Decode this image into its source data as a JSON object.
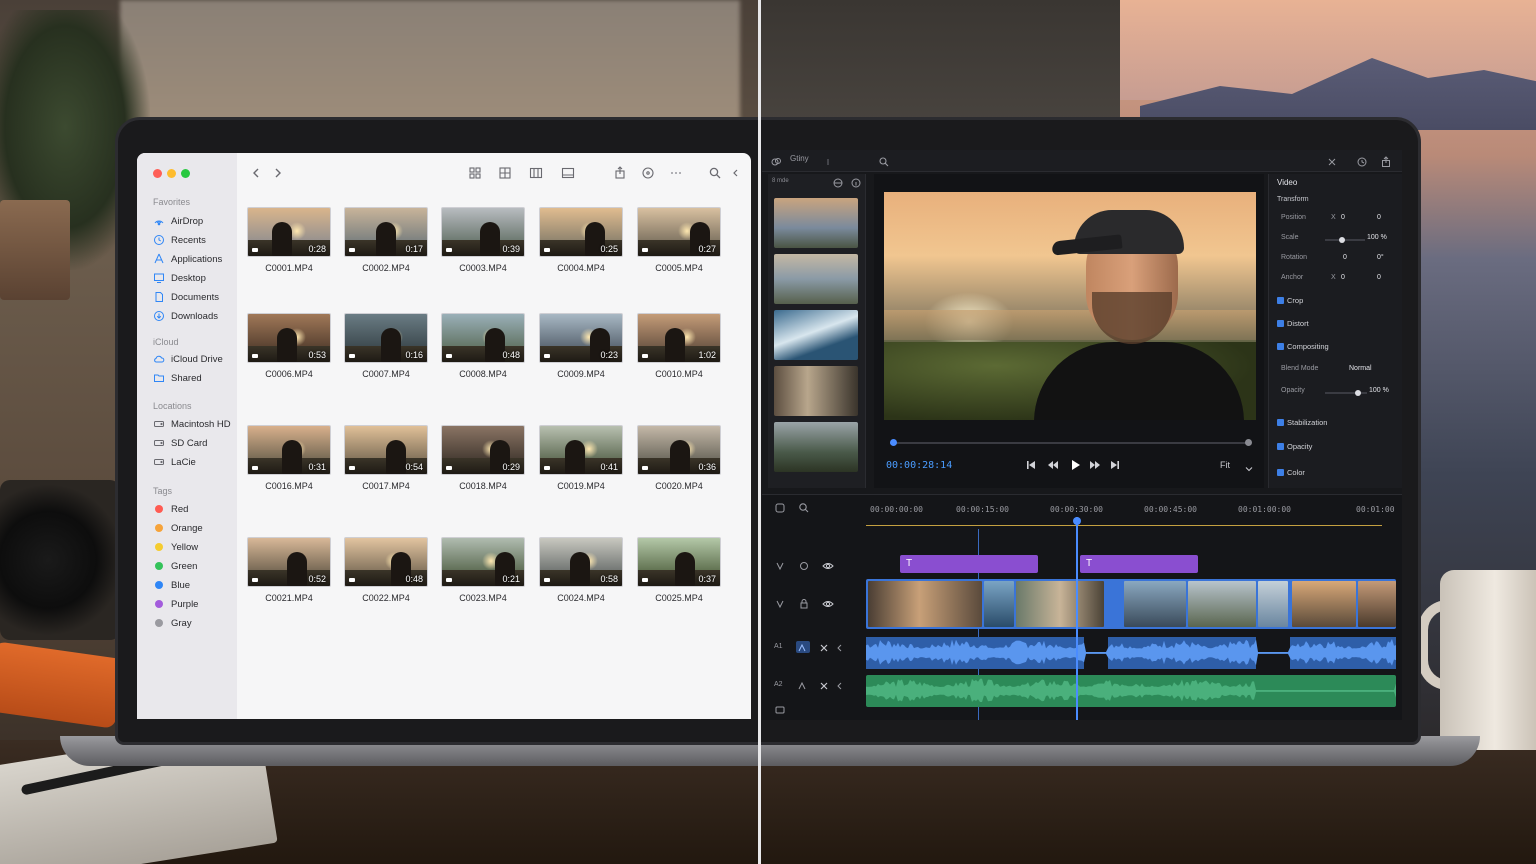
{
  "finder": {
    "sidebar": {
      "favorites_label": "Favorites",
      "favorites": [
        {
          "label": "AirDrop",
          "icon": "airdrop-icon"
        },
        {
          "label": "Recents",
          "icon": "clock-icon"
        },
        {
          "label": "Applications",
          "icon": "applications-icon"
        },
        {
          "label": "Desktop",
          "icon": "desktop-icon"
        },
        {
          "label": "Documents",
          "icon": "document-icon"
        },
        {
          "label": "Downloads",
          "icon": "download-icon"
        }
      ],
      "icloud_label": "iCloud",
      "icloud": [
        {
          "label": "iCloud Drive",
          "icon": "cloud-icon"
        },
        {
          "label": "Shared",
          "icon": "shared-folder-icon"
        }
      ],
      "locations_label": "Locations",
      "locations": [
        {
          "label": "Macintosh HD",
          "icon": "disk-icon"
        },
        {
          "label": "SD Card",
          "icon": "disk-icon"
        },
        {
          "label": "LaCie",
          "icon": "disk-icon"
        }
      ],
      "tags_label": "Tags",
      "tags": [
        {
          "label": "Red",
          "color": "#ff5b52"
        },
        {
          "label": "Orange",
          "color": "#f6a33a"
        },
        {
          "label": "Yellow",
          "color": "#f5cc2f"
        },
        {
          "label": "Green",
          "color": "#34c25a"
        },
        {
          "label": "Blue",
          "color": "#2f86f6"
        },
        {
          "label": "Purple",
          "color": "#a35cdc"
        },
        {
          "label": "Gray",
          "color": "#9a9aa0"
        }
      ]
    },
    "files": [
      {
        "name": "C0001.MP4",
        "duration": "0:28"
      },
      {
        "name": "C0002.MP4",
        "duration": "0:17"
      },
      {
        "name": "C0003.MP4",
        "duration": "0:39"
      },
      {
        "name": "C0004.MP4",
        "duration": "0:25"
      },
      {
        "name": "C0005.MP4",
        "duration": "0:27"
      },
      {
        "name": "C0006.MP4",
        "duration": "0:53"
      },
      {
        "name": "C0007.MP4",
        "duration": "0:16"
      },
      {
        "name": "C0008.MP4",
        "duration": "0:48"
      },
      {
        "name": "C0009.MP4",
        "duration": "0:23"
      },
      {
        "name": "C0010.MP4",
        "duration": "1:02"
      },
      {
        "name": "C0016.MP4",
        "duration": "0:31"
      },
      {
        "name": "C0017.MP4",
        "duration": "0:54"
      },
      {
        "name": "C0018.MP4",
        "duration": "0:29"
      },
      {
        "name": "C0019.MP4",
        "duration": "0:41"
      },
      {
        "name": "C0020.MP4",
        "duration": "0:36"
      },
      {
        "name": "C0021.MP4",
        "duration": "0:52"
      },
      {
        "name": "C0022.MP4",
        "duration": "0:48"
      },
      {
        "name": "C0023.MP4",
        "duration": "0:21"
      },
      {
        "name": "C0024.MP4",
        "duration": "0:58"
      },
      {
        "name": "C0025.MP4",
        "duration": "0:37"
      }
    ]
  },
  "editor": {
    "top_tab": "Gtiny",
    "bin_label": "8 mde",
    "viewer": {
      "timecode": "00:00:28:14",
      "zoom": "Fit",
      "progress": 0.0
    },
    "inspector": {
      "title": "Video",
      "transform_label": "Transform",
      "position_label": "Position",
      "position_x_axis": "X",
      "position_x": "0",
      "position_y": "0",
      "scale_label": "Scale",
      "scale_value": "100 %",
      "rotation_label": "Rotation",
      "rotation_value": "0",
      "rotation_deg": "0°",
      "anchor_label": "Anchor",
      "anchor_x_axis": "X",
      "anchor_x": "0",
      "anchor_y": "0",
      "crop": "Crop",
      "distort": "Distort",
      "compositing": "Compositing",
      "blend_mode_label": "Blend Mode",
      "blend_mode_value": "Normal",
      "opacity_label": "Opacity",
      "opacity_value": "100 %",
      "stabilization": "Stabilization",
      "opacity_section": "Opacity",
      "color_section": "Color"
    },
    "timeline": {
      "ruler": [
        "00:00:00:00",
        "00:00:15:00",
        "00:00:30:00",
        "00:00:45:00",
        "00:01:00:00",
        "00:01:00"
      ],
      "title_clip_1": "T",
      "title_clip_2": "T",
      "audio_track_1_label": "A1",
      "audio_track_2_label": "A2"
    }
  },
  "colors": {
    "accent_blue": "#4a8cff",
    "title_clip_purple": "#8a4ed0",
    "video_track_blue": "#3a74d8",
    "audio_green": "#2c8a58"
  }
}
